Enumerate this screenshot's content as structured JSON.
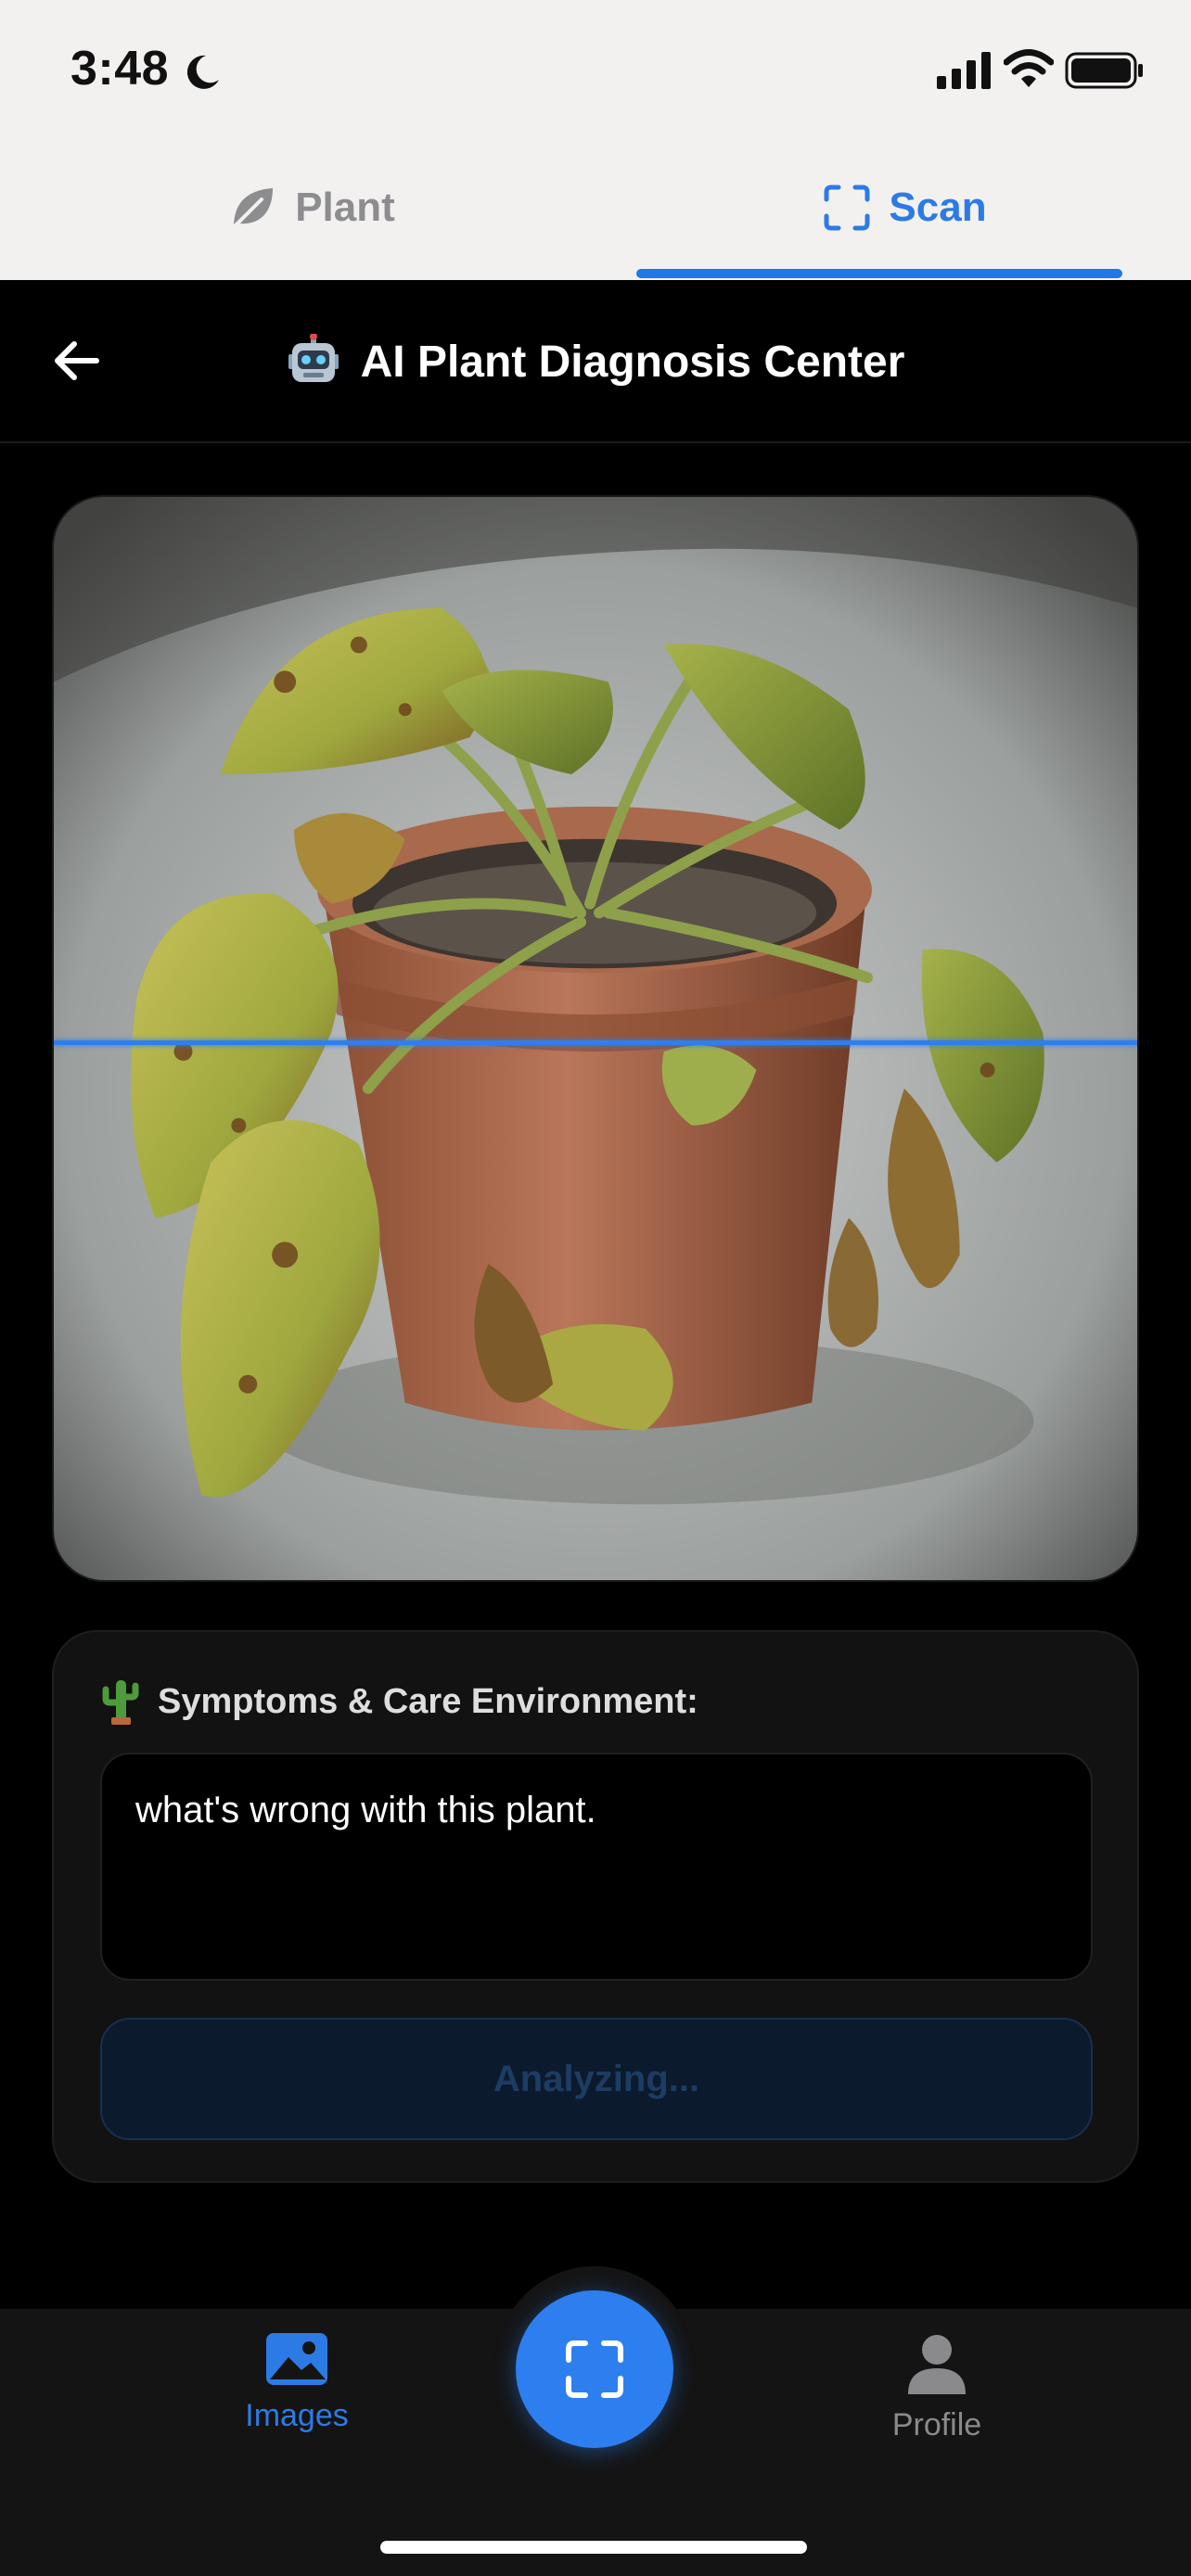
{
  "status_bar": {
    "time": "3:48",
    "icons": [
      "moon-icon",
      "signal-icon",
      "wifi-icon",
      "battery-icon"
    ]
  },
  "top_tabs": [
    {
      "label": "Plant",
      "icon": "leaf-icon",
      "active": false
    },
    {
      "label": "Scan",
      "icon": "scan-frame-icon",
      "active": true
    }
  ],
  "header": {
    "title": "AI Plant Diagnosis Center",
    "icon": "robot-icon",
    "back_icon": "back-arrow-icon"
  },
  "photo": {
    "icon": "plant-photo",
    "scanning": true
  },
  "symptoms": {
    "label": "Symptoms & Care Environment:",
    "icon": "cactus-icon",
    "value": "what's wrong with this plant.",
    "button_label": "Analyzing..."
  },
  "bottom_nav": {
    "items": [
      {
        "label": "Images",
        "icon": "image-icon",
        "active": true
      },
      {
        "label": "Profile",
        "icon": "person-icon",
        "active": false
      }
    ],
    "center_action_icon": "scan-frame-icon"
  },
  "colors": {
    "accent": "#2d7ff0",
    "background": "#000000",
    "top_bar": "#f3f1f0",
    "card": "#121212",
    "inactive": "#8a8a8c"
  }
}
